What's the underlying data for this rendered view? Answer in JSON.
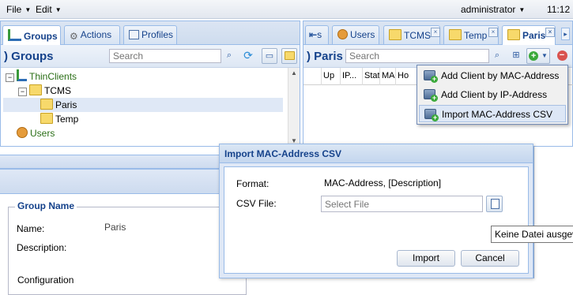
{
  "menubar": {
    "file": "File",
    "edit": "Edit",
    "user": "administrator",
    "time": "11:12"
  },
  "left_panel": {
    "tabs": {
      "groups": "Groups",
      "actions": "Actions",
      "profiles": "Profiles"
    },
    "title": "Groups",
    "search_placeholder": "Search",
    "tree": {
      "root": "ThinClients",
      "tcms": "TCMS",
      "paris": "Paris",
      "temp": "Temp",
      "users": "Users"
    }
  },
  "right_panel": {
    "tabs": {
      "overflow": "s",
      "users": "Users",
      "tcms": "TCMS",
      "temp": "Temp",
      "paris": "Paris"
    },
    "title": "Paris",
    "search_placeholder": "Search",
    "columns": [
      "Up",
      "IP...",
      "Stat",
      "MAC",
      "Ho"
    ]
  },
  "add_menu": {
    "items": [
      "Add Client by MAC-Address",
      "Add Client by IP-Address",
      "Import MAC-Address CSV"
    ]
  },
  "details": {
    "group_name_legend": "Group Name",
    "name_label": "Name:",
    "name_value": "Paris",
    "description_label": "Description:",
    "config_label": "Configuration"
  },
  "dialog": {
    "title": "Import MAC-Address CSV",
    "format_label": "Format:",
    "format_value": "MAC-Address, [Description]",
    "csv_label": "CSV File:",
    "csv_placeholder": "Select File",
    "import_button": "Import",
    "cancel_button": "Cancel"
  },
  "tooltip": "Keine Datei ausgewählt"
}
